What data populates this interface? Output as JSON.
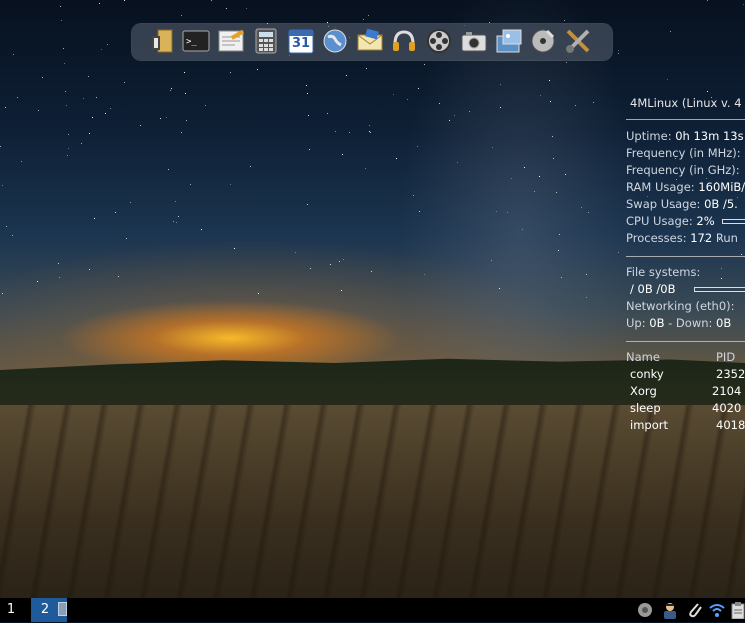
{
  "dock": {
    "icons": [
      "file-manager-icon",
      "terminal-icon",
      "text-editor-icon",
      "calculator-icon",
      "calendar-icon",
      "web-browser-icon",
      "mail-icon",
      "audio-player-icon",
      "video-player-icon",
      "screenshot-icon",
      "image-viewer-icon",
      "cd-burner-icon",
      "settings-tools-icon"
    ],
    "calendar_day": "31"
  },
  "conky": {
    "title": "4MLinux (Linux v. 4",
    "uptime_label": "Uptime:",
    "uptime_value": "0h 13m 13s",
    "freq_mhz": "Frequency (in MHz):",
    "freq_ghz": "Frequency (in GHz):",
    "ram_label": "RAM Usage:",
    "ram_value": "160MiB/",
    "swap_label": "Swap Usage:",
    "swap_value": "0B /5.",
    "cpu_label": "CPU Usage:",
    "cpu_value": "2%",
    "proc_label": "Processes:",
    "proc_value": "172",
    "proc_running": "Run",
    "fs_label": "File systems:",
    "fs_value": "/  0B  /0B",
    "net_label": "Networking (eth0):",
    "up_label": "Up:",
    "up_value": "0B",
    "down_label": "- Down:",
    "down_value": "0B",
    "table_headers": [
      "Name",
      "PID"
    ],
    "processes": [
      {
        "name": "conky",
        "pid": "2352"
      },
      {
        "name": "Xorg",
        "pid": "2104"
      },
      {
        "name": "sleep",
        "pid": "4020"
      },
      {
        "name": "import",
        "pid": "4018"
      }
    ]
  },
  "taskbar": {
    "workspace_1": "1",
    "workspace_2": "2"
  }
}
